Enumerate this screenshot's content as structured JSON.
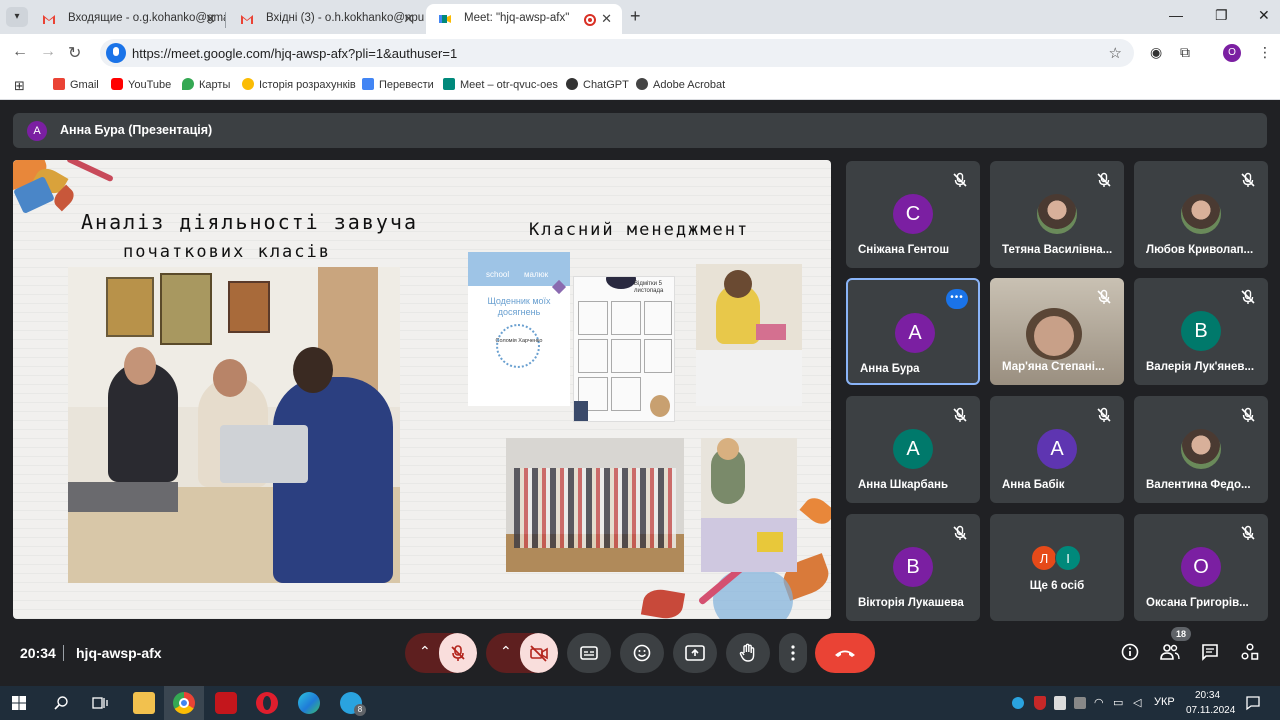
{
  "browser": {
    "tabs": [
      {
        "title": "Входящие - o.g.kohanko@gma",
        "favicon": "gmail-icon",
        "active": false
      },
      {
        "title": "Вхідні (3) - o.h.kokhanko@npu",
        "favicon": "gmail-icon",
        "active": false
      },
      {
        "title": "Meet: \"hjq-awsp-afx\"",
        "favicon": "meet-icon",
        "active": true
      }
    ],
    "url": "https://meet.google.com/hjq-awsp-afx?pli=1&authuser=1",
    "profile_initial": "O",
    "bookmarks": [
      {
        "label": "Gmail",
        "color": "#ea4335"
      },
      {
        "label": "YouTube",
        "color": "#ff0000"
      },
      {
        "label": "Карты",
        "color": "#34a853"
      },
      {
        "label": "Історія розрахунків",
        "color": "#fbbc04"
      },
      {
        "label": "Перевести",
        "color": "#4285f4"
      },
      {
        "label": "Meet – otr-qvuc-oes",
        "color": "#00897b"
      },
      {
        "label": "ChatGPT",
        "color": "#333333"
      },
      {
        "label": "Adobe Acrobat",
        "color": "#444444"
      }
    ]
  },
  "meet": {
    "presenter": {
      "initial": "А",
      "label": "Анна Бура (Презентація)"
    },
    "slide": {
      "title_left_line1": "Аналіз діяльності завуча",
      "title_left_line2": "початкових класів",
      "title_right": "Класний менеджмент",
      "diary_header_left": "school",
      "diary_header_right": "малюк",
      "diary_title": "Щоденник моїх досягнень",
      "diary_name": "Соломія Харченко",
      "chart_title": "Відмітки 5 листопада"
    },
    "participants": [
      {
        "name": "Сніжана Гентош",
        "initial": "С",
        "color": "#7b1fa2",
        "muted": true
      },
      {
        "name": "Тетяна Василівна...",
        "photo": true,
        "muted": true
      },
      {
        "name": "Любов Криволап...",
        "photo": true,
        "muted": true
      },
      {
        "name": "Анна Бура",
        "initial": "А",
        "color": "#7b1fa2",
        "muted": false,
        "active": true
      },
      {
        "name": "Мар'яна Степані...",
        "video": true,
        "muted": true
      },
      {
        "name": "Валерія Лук'янев...",
        "initial": "В",
        "color": "#00796b",
        "muted": true
      },
      {
        "name": "Анна Шкарбань",
        "initial": "А",
        "color": "#00796b",
        "muted": true
      },
      {
        "name": "Анна Бабік",
        "initial": "А",
        "color": "#5e35b1",
        "muted": true
      },
      {
        "name": "Валентина Федо...",
        "photo": true,
        "muted": true
      },
      {
        "name": "Вікторія Лукашева",
        "initial": "В",
        "color": "#7b1fa2",
        "muted": true
      },
      {
        "name": "Ще 6 осіб",
        "more": [
          "Л",
          "І"
        ],
        "muted": false
      },
      {
        "name": "Оксана Григорів...",
        "initial": "О",
        "color": "#7b1fa2",
        "muted": true
      }
    ],
    "time": "20:34",
    "code": "hjq-awsp-afx",
    "participant_count": "18"
  },
  "taskbar": {
    "language": "УКР",
    "time": "20:34",
    "date": "07.11.2024",
    "telegram_badge": "8"
  }
}
